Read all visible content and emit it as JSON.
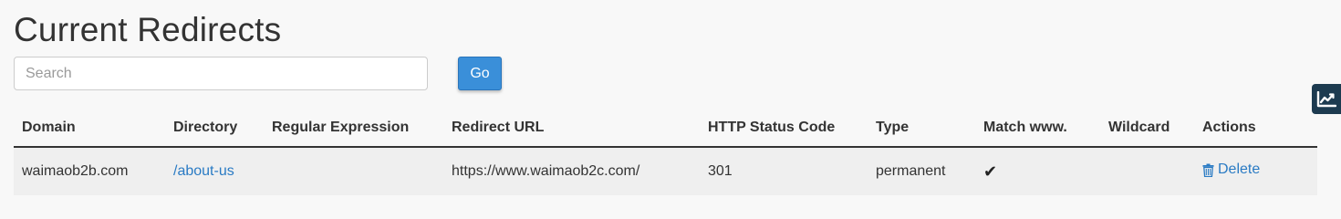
{
  "page": {
    "title": "Current Redirects"
  },
  "search": {
    "placeholder": "Search",
    "value": "",
    "go_label": "Go"
  },
  "table": {
    "columns": [
      "Domain",
      "Directory",
      "Regular Expression",
      "Redirect URL",
      "HTTP Status Code",
      "Type",
      "Match www.",
      "Wildcard",
      "Actions"
    ],
    "rows": [
      {
        "domain": "waimaob2b.com",
        "directory": "/about-us",
        "regex": "",
        "redirect_url": "https://www.waimaob2c.com/",
        "status_code": "301",
        "type": "permanent",
        "match_www": "✔",
        "wildcard": "",
        "action_label": "Delete"
      }
    ]
  },
  "icons": {
    "stats_tab": "chart-line-icon",
    "delete": "trash-icon",
    "match_www": "checkmark-icon"
  },
  "colors": {
    "link": "#2a7bc4",
    "button": "#3a8fd9",
    "stats_tab": "#1d3b50"
  }
}
